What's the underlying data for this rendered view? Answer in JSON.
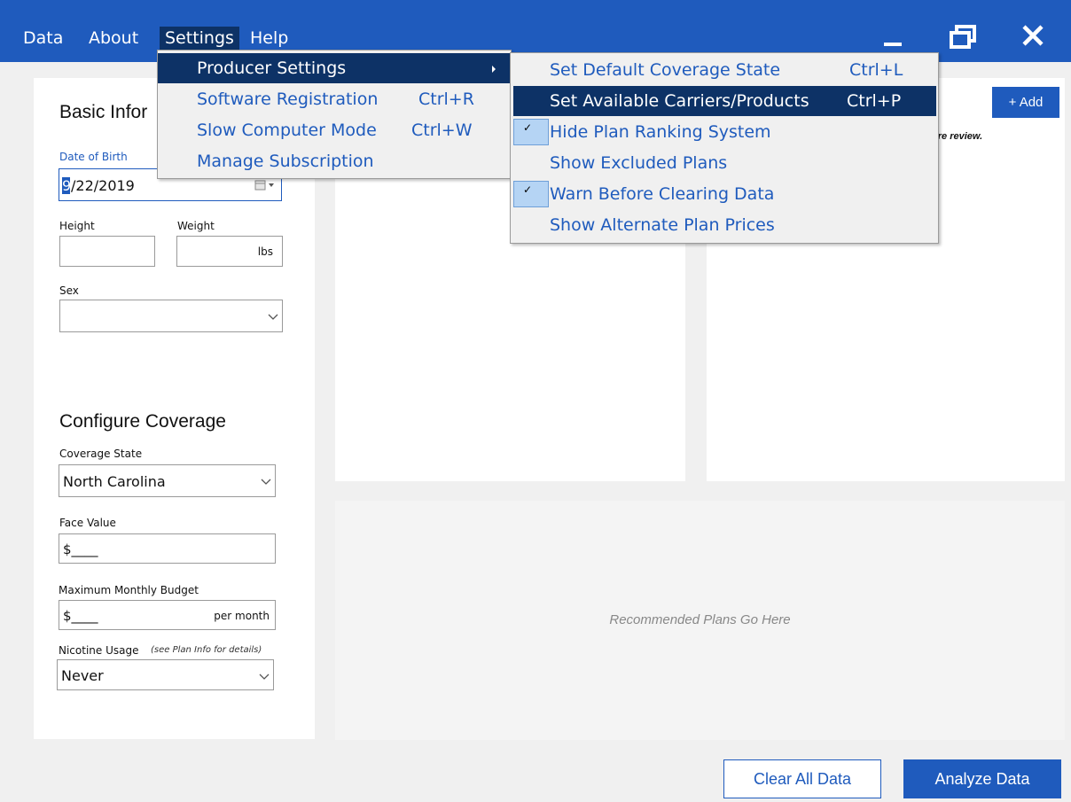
{
  "menubar": {
    "items": [
      "Data",
      "About",
      "Settings",
      "Help"
    ]
  },
  "settings_menu": {
    "items": [
      {
        "label": "Producer Settings",
        "shortcut": "",
        "submenu": true
      },
      {
        "label": "Software Registration",
        "shortcut": "Ctrl+R"
      },
      {
        "label": "Slow Computer Mode",
        "shortcut": "Ctrl+W"
      },
      {
        "label": "Manage Subscription",
        "shortcut": ""
      }
    ]
  },
  "producer_submenu": {
    "items": [
      {
        "label": "Set Default Coverage State",
        "shortcut": "Ctrl+L",
        "checked": false
      },
      {
        "label": "Set Available Carriers/Products",
        "shortcut": "Ctrl+P",
        "checked": false
      },
      {
        "label": "Hide Plan Ranking System",
        "shortcut": "",
        "checked": true
      },
      {
        "label": "Show Excluded Plans",
        "shortcut": "",
        "checked": false
      },
      {
        "label": "Warn Before Clearing Data",
        "shortcut": "",
        "checked": true
      },
      {
        "label": "Show Alternate Plan Prices",
        "shortcut": "",
        "checked": false
      }
    ]
  },
  "basic_info": {
    "heading": "Basic Infor",
    "dob_label": "Date of Birth",
    "dob_cursor": "9",
    "dob_rest": "/22/2019",
    "height_label": "Height",
    "weight_label": "Weight",
    "weight_unit": "lbs",
    "sex_label": "Sex"
  },
  "coverage": {
    "heading": "Configure Coverage",
    "state_label": "Coverage State",
    "state_value": "North Carolina",
    "face_label": "Face Value",
    "face_value": "$____",
    "budget_label": "Maximum Monthly Budget",
    "budget_value": "$____",
    "budget_unit": "per month",
    "nicotine_label": "Nicotine Usage",
    "nicotine_note": "(see Plan Info for details)",
    "nicotine_value": "Never"
  },
  "right_panel": {
    "add_button": "+ Add",
    "note": "uire review."
  },
  "recommended": {
    "placeholder": "Recommended Plans Go Here"
  },
  "footer": {
    "clear_button": "Clear All Data",
    "analyze_button": "Analyze Data"
  }
}
